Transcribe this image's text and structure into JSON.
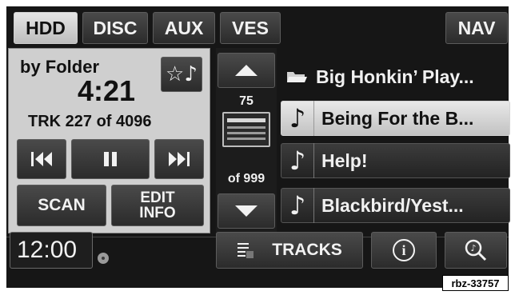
{
  "tabs": [
    {
      "label": "HDD",
      "active": true
    },
    {
      "label": "DISC",
      "active": false
    },
    {
      "label": "AUX",
      "active": false
    },
    {
      "label": "VES",
      "active": false
    }
  ],
  "nav_label": "NAV",
  "now_playing": {
    "mode": "by Folder",
    "time": "4:21",
    "track_info": "TRK 227 of 4096"
  },
  "controls": {
    "scan_label": "SCAN",
    "edit_info_line1": "EDIT",
    "edit_info_line2": "INFO"
  },
  "browser": {
    "position": "75",
    "total": "of 999",
    "folder_name": "Big Honkin’ Play...",
    "tracks": [
      {
        "title": "Being For the B...",
        "selected": true
      },
      {
        "title": "Help!",
        "selected": false
      },
      {
        "title": "Blackbird/Yest...",
        "selected": false
      }
    ]
  },
  "bottom": {
    "clock": "12:00",
    "tracks_label": "TRACKS"
  },
  "caption": "rbz-33757",
  "icons": [
    "favorite-music-icon",
    "skip-back-icon",
    "pause-icon",
    "skip-forward-icon",
    "scroll-up-icon",
    "list-icon",
    "scroll-down-icon",
    "folder-icon",
    "music-note-icon",
    "tracks-list-icon",
    "info-icon",
    "search-music-icon",
    "disc-indicator-icon"
  ],
  "colors": {
    "screen_bg": "#161616",
    "panel_bg": "#cfcfcf",
    "selected_bg": "#e0e0e0"
  }
}
